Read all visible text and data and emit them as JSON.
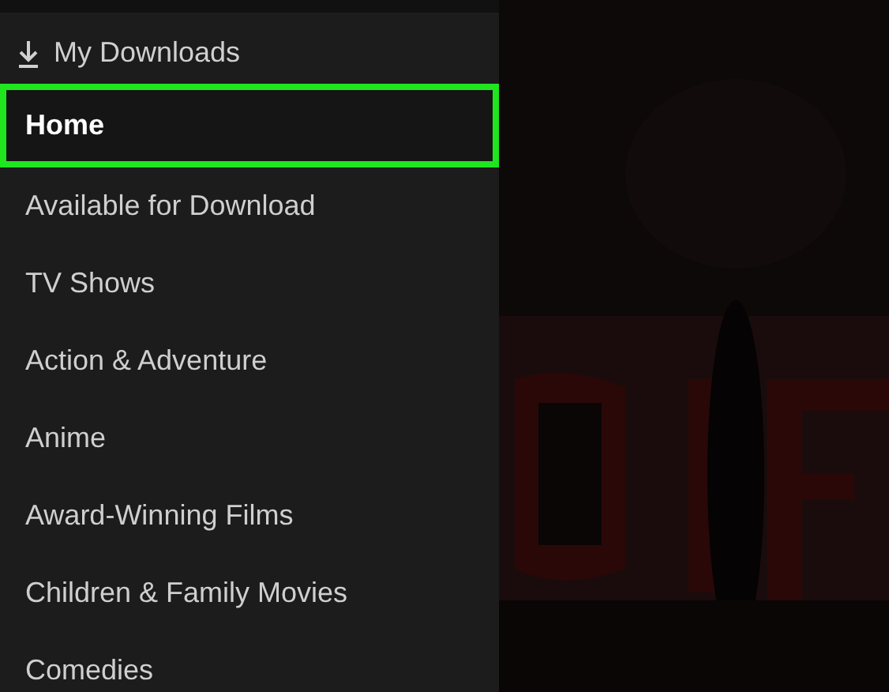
{
  "downloads": {
    "label": "My Downloads"
  },
  "menu": [
    {
      "label": "Home",
      "selected": true
    },
    {
      "label": "Available for Download",
      "selected": false
    },
    {
      "label": "TV Shows",
      "selected": false
    },
    {
      "label": "Action & Adventure",
      "selected": false
    },
    {
      "label": "Anime",
      "selected": false
    },
    {
      "label": "Award-Winning Films",
      "selected": false
    },
    {
      "label": "Children & Family Movies",
      "selected": false
    },
    {
      "label": "Comedies",
      "selected": false
    }
  ]
}
